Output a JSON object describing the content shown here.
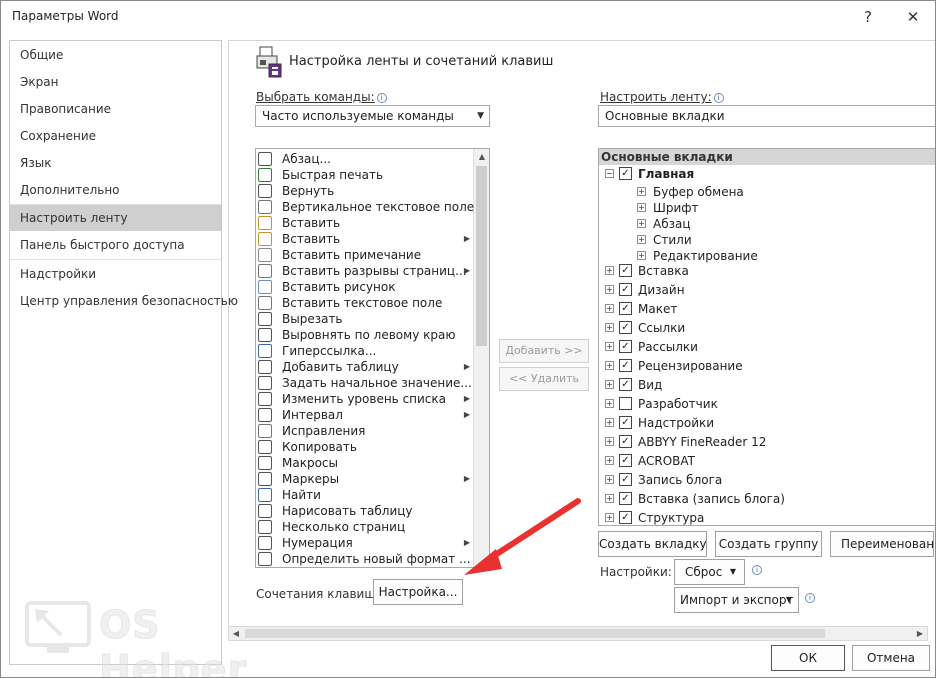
{
  "window": {
    "title": "Параметры Word",
    "help": "?",
    "close": "✕"
  },
  "nav": {
    "items": [
      "Общие",
      "Экран",
      "Правописание",
      "Сохранение",
      "Язык",
      "Дополнительно",
      "Настроить ленту",
      "Панель быстрого доступа",
      "Надстройки",
      "Центр управления безопасностью"
    ],
    "selected": "Настроить ленту"
  },
  "section": {
    "title": "Настройка ленты и сочетаний клавиш"
  },
  "left": {
    "label": "Выбрать команды:",
    "combo_value": "Часто используемые команды",
    "commands": [
      {
        "label": "Абзац...",
        "submenu": false
      },
      {
        "label": "Быстрая печать",
        "submenu": false
      },
      {
        "label": "Вернуть",
        "submenu": false
      },
      {
        "label": "Вертикальное текстовое поле",
        "submenu": false
      },
      {
        "label": "Вставить",
        "submenu": false
      },
      {
        "label": "Вставить",
        "submenu": true
      },
      {
        "label": "Вставить примечание",
        "submenu": false
      },
      {
        "label": "Вставить разрывы страниц...",
        "submenu": true
      },
      {
        "label": "Вставить рисунок",
        "submenu": false
      },
      {
        "label": "Вставить текстовое поле",
        "submenu": false
      },
      {
        "label": "Вырезать",
        "submenu": false
      },
      {
        "label": "Выровнять по левому краю",
        "submenu": false
      },
      {
        "label": "Гиперссылка...",
        "submenu": false
      },
      {
        "label": "Добавить таблицу",
        "submenu": true
      },
      {
        "label": "Задать начальное значение...",
        "submenu": false
      },
      {
        "label": "Изменить уровень списка",
        "submenu": true
      },
      {
        "label": "Интервал",
        "submenu": true
      },
      {
        "label": "Исправления",
        "submenu": false
      },
      {
        "label": "Копировать",
        "submenu": false
      },
      {
        "label": "Макросы",
        "submenu": false
      },
      {
        "label": "Маркеры",
        "submenu": true
      },
      {
        "label": "Найти",
        "submenu": false
      },
      {
        "label": "Нарисовать таблицу",
        "submenu": false
      },
      {
        "label": "Несколько страниц",
        "submenu": false
      },
      {
        "label": "Нумерация",
        "submenu": true
      },
      {
        "label": "Определить новый формат ...",
        "submenu": false
      }
    ],
    "shortcuts_label": "Сочетания клавиш:",
    "shortcuts_button": "Настройка..."
  },
  "middle": {
    "add": "Добавить >>",
    "remove": "<< Удалить"
  },
  "right": {
    "label": "Настроить ленту:",
    "combo_value": "Основные вкладки",
    "header": "Основные вкладки",
    "home": {
      "label": "Главная",
      "checked": true,
      "expanded": true,
      "groups": [
        "Буфер обмена",
        "Шрифт",
        "Абзац",
        "Стили",
        "Редактирование"
      ]
    },
    "tabs": [
      {
        "label": "Вставка",
        "checked": true
      },
      {
        "label": "Дизайн",
        "checked": true
      },
      {
        "label": "Макет",
        "checked": true
      },
      {
        "label": "Ссылки",
        "checked": true
      },
      {
        "label": "Рассылки",
        "checked": true
      },
      {
        "label": "Рецензирование",
        "checked": true
      },
      {
        "label": "Вид",
        "checked": true
      },
      {
        "label": "Разработчик",
        "checked": false
      },
      {
        "label": "Надстройки",
        "checked": true
      },
      {
        "label": "ABBYY FineReader 12",
        "checked": true
      },
      {
        "label": "ACROBAT",
        "checked": true
      },
      {
        "label": "Запись блога",
        "checked": true
      },
      {
        "label": "Вставка (запись блога)",
        "checked": true
      },
      {
        "label": "Структура",
        "checked": true
      }
    ],
    "new_tab": "Создать вкладку",
    "new_group": "Создать группу",
    "rename": "Переименовани",
    "settings_label": "Настройки:",
    "reset": "Сброс",
    "import_export": "Импорт и экспорт"
  },
  "footer": {
    "ok": "ОК",
    "cancel": "Отмена"
  },
  "watermark": {
    "text": "OS Helper"
  },
  "colors": {
    "selected_nav": "#cfcfcf",
    "arrow": "#e8322f",
    "header_bg": "#d6d6d6"
  }
}
